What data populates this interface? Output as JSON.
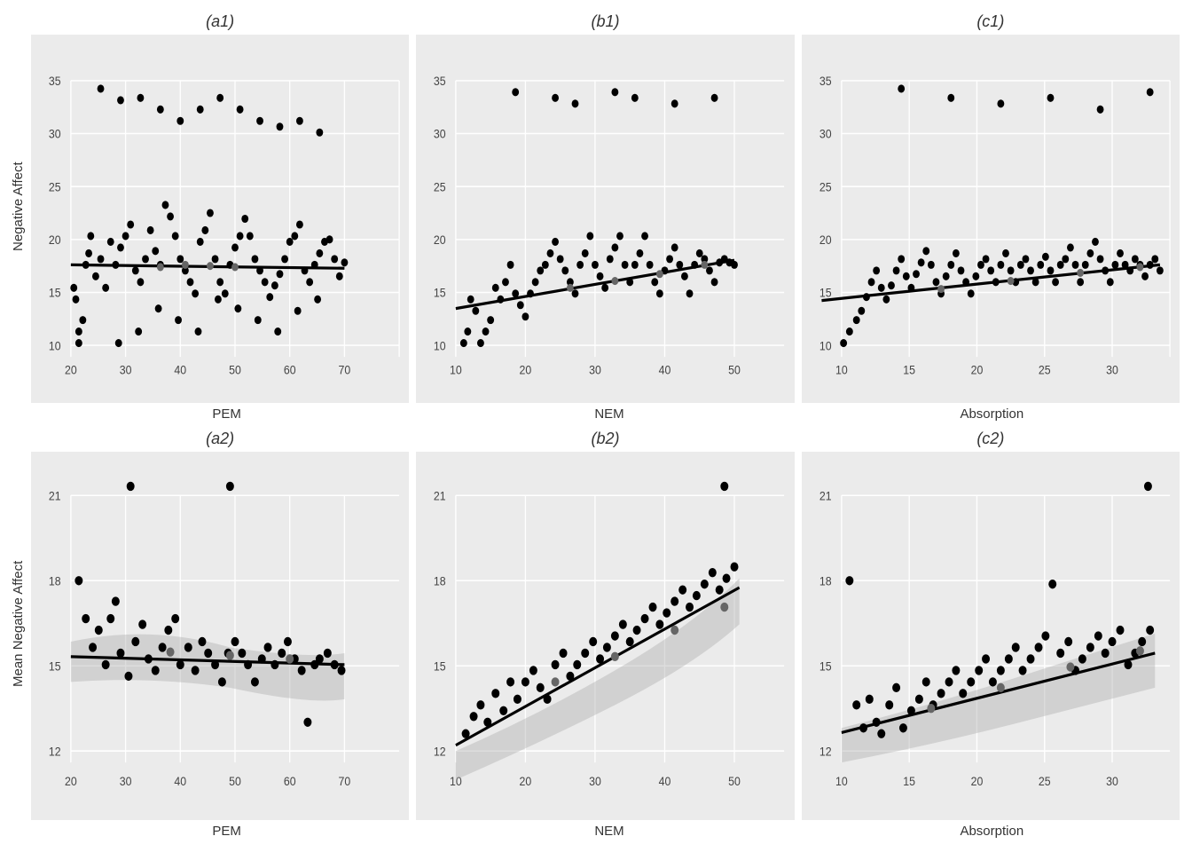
{
  "panels": {
    "row1": {
      "yLabel": "Negative Affect",
      "plots": [
        {
          "id": "a1",
          "title": "(a1)",
          "xLabel": "PEM",
          "xTicks": [
            "20",
            "30",
            "40",
            "50",
            "60",
            "70"
          ],
          "yTicks": [
            "10",
            "15",
            "20",
            "25",
            "30",
            "35"
          ],
          "xMin": 17,
          "xMax": 72,
          "yMin": 9,
          "yMax": 37
        },
        {
          "id": "b1",
          "title": "(b1)",
          "xLabel": "NEM",
          "xTicks": [
            "10",
            "20",
            "30",
            "40",
            "50"
          ],
          "yTicks": [
            "10",
            "15",
            "20",
            "25",
            "30",
            "35"
          ],
          "xMin": 5,
          "xMax": 53,
          "yMin": 9,
          "yMax": 37
        },
        {
          "id": "c1",
          "title": "(c1)",
          "xLabel": "Absorption",
          "xTicks": [
            "10",
            "15",
            "20",
            "25",
            "30"
          ],
          "yTicks": [
            "10",
            "15",
            "20",
            "25",
            "30",
            "35"
          ],
          "xMin": 5,
          "xMax": 33,
          "yMin": 9,
          "yMax": 37
        }
      ]
    },
    "row2": {
      "yLabel": "Mean Negative Affect",
      "plots": [
        {
          "id": "a2",
          "title": "(a2)",
          "xLabel": "PEM",
          "xTicks": [
            "20",
            "30",
            "40",
            "50",
            "60",
            "70"
          ],
          "yTicks": [
            "12",
            "15",
            "18",
            "21"
          ],
          "xMin": 17,
          "xMax": 72,
          "yMin": 11,
          "yMax": 23
        },
        {
          "id": "b2",
          "title": "(b2)",
          "xLabel": "NEM",
          "xTicks": [
            "10",
            "20",
            "30",
            "40",
            "50"
          ],
          "yTicks": [
            "12",
            "15",
            "18",
            "21"
          ],
          "xMin": 5,
          "xMax": 53,
          "yMin": 11,
          "yMax": 23
        },
        {
          "id": "c2",
          "title": "(c2)",
          "xLabel": "Absorption",
          "xTicks": [
            "10",
            "15",
            "20",
            "25",
            "30"
          ],
          "yTicks": [
            "12",
            "15",
            "18",
            "21"
          ],
          "xMin": 5,
          "xMax": 33,
          "yMin": 11,
          "yMax": 23
        }
      ]
    }
  }
}
